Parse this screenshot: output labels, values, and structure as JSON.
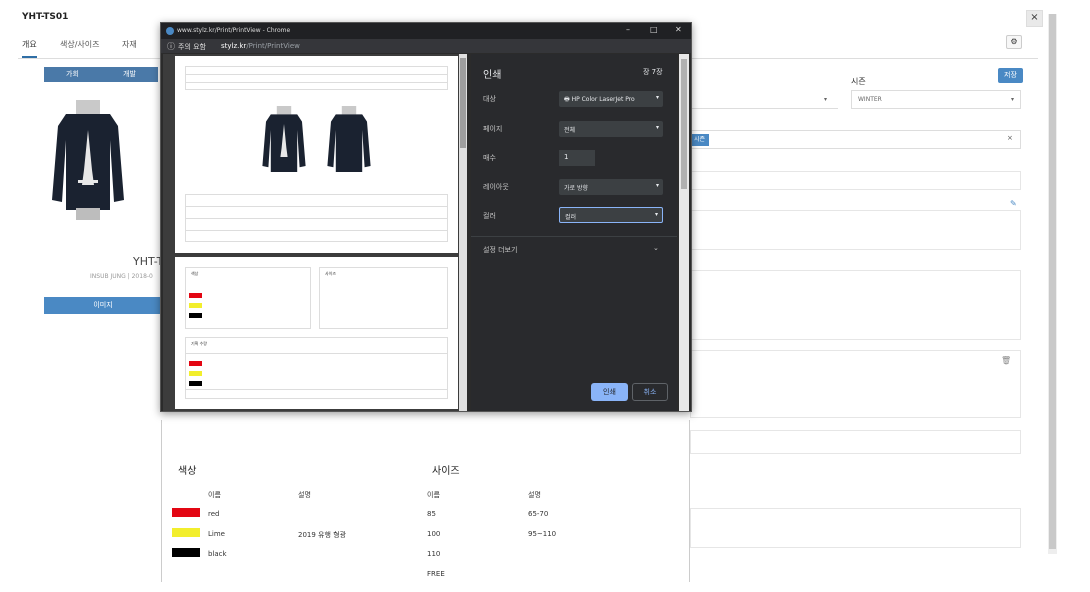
{
  "app": {
    "title": "YHT-TS01",
    "close": "×",
    "tabs": [
      "개요",
      "색상/사이즈",
      "자재"
    ],
    "left_buttons": [
      "가회",
      "개발"
    ],
    "style_code_fragment": "YHT-T",
    "designer_fragment": "INSUB JUNG | 2018-0",
    "image_button": "이미지",
    "save_button": "저장",
    "season_label": "시즌",
    "season_value": "WINTER",
    "tag_chip": "시즌"
  },
  "chrome": {
    "title": "www.stylz.kr/Print/PrintView - Chrome",
    "warning": "주의 요함",
    "url_host": "stylz.kr",
    "url_path": "/Print/PrintView"
  },
  "print_settings": {
    "title": "인쇄",
    "page_count": "장 7장",
    "rows": [
      {
        "label": "대상",
        "value": "HP Color LaserJet Pro"
      },
      {
        "label": "페이지",
        "value": "전체"
      },
      {
        "label": "매수",
        "value": "1"
      },
      {
        "label": "레이아웃",
        "value": "가로 방향"
      },
      {
        "label": "컬러",
        "value": "컬러"
      }
    ],
    "more_settings": "설정 더보기",
    "print_button": "인쇄",
    "cancel_button": "취소"
  },
  "preview_page": {
    "color_heading": "색상",
    "size_heading": "사이즈",
    "col_name": "이름",
    "col_desc": "설명",
    "colors": [
      {
        "name": "red",
        "desc": "",
        "swatch": "#e30613"
      },
      {
        "name": "Lime",
        "desc": "2019 유행 형광",
        "swatch": "#f2ee2c"
      },
      {
        "name": "black",
        "desc": "",
        "swatch": "#000000"
      }
    ],
    "sizes": [
      {
        "name": "85",
        "desc": "65-70"
      },
      {
        "name": "100",
        "desc": "95~110"
      },
      {
        "name": "110",
        "desc": ""
      },
      {
        "name": "FREE",
        "desc": ""
      }
    ]
  },
  "sheet2": {
    "color_heading": "색상",
    "size_heading": "사이즈",
    "plan_heading": "기획 수량"
  }
}
